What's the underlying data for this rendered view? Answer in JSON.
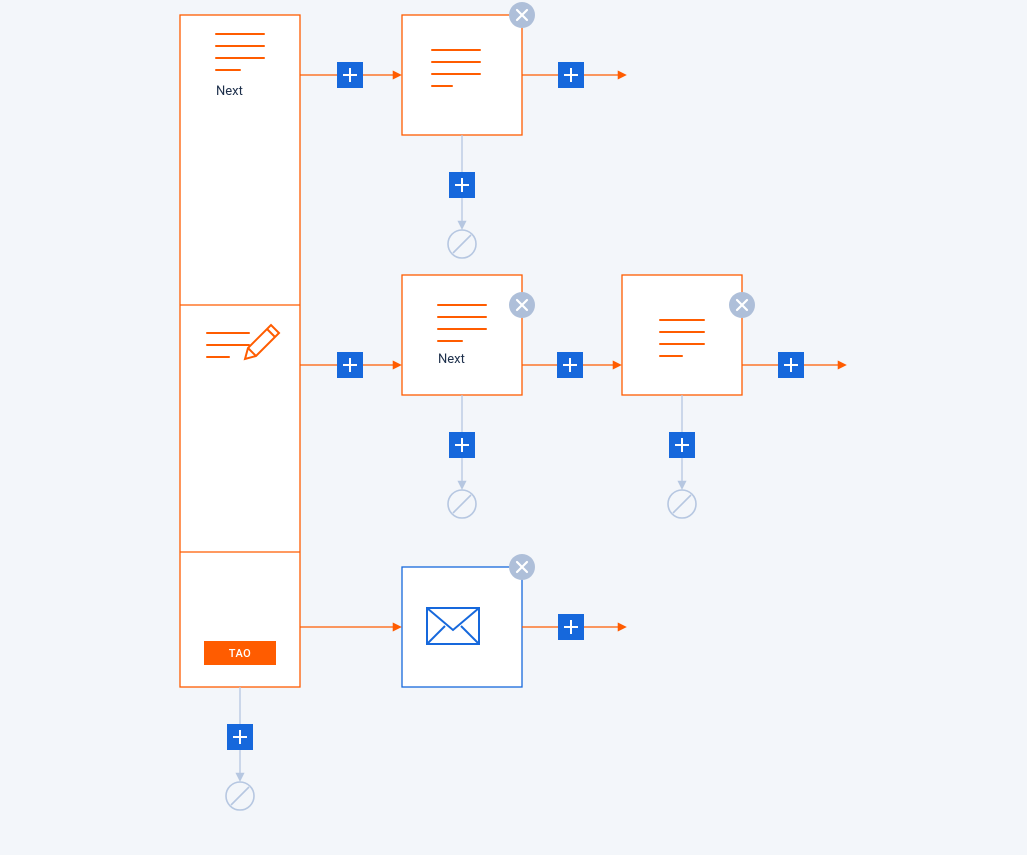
{
  "colors": {
    "bg": "#F3F6FA",
    "orange": "#FF5C00",
    "blue": "#1668DC",
    "textDark": "#1D2F4B",
    "lightBlue": "#B6C7E1",
    "closeFill": "#AEBFD9"
  },
  "rootStack": {
    "badge": "TAO",
    "segments": {
      "seg1": {
        "label": "Next",
        "icon": "lines-left"
      },
      "seg2": {
        "icon": "edit"
      },
      "seg3": {
        "badge": "TAO"
      }
    }
  },
  "rows": {
    "row1": {
      "plusMid": true,
      "node": {
        "icon": "lines-left-short",
        "closable": true,
        "label": ""
      },
      "plusRight": true,
      "endArrow": true,
      "plusDown": true,
      "endCircle": true
    },
    "row2": {
      "plusMid": true,
      "nodeA": {
        "icon": "lines-left-short",
        "label": "Next",
        "closable": true
      },
      "plusAB": true,
      "nodeB": {
        "icon": "lines-center",
        "label": "",
        "closable": true
      },
      "plusRight": true,
      "endArrow": true,
      "plusDownA": true,
      "endCircleA": true,
      "plusDownB": true,
      "endCircleB": true
    },
    "row3": {
      "noMidPlus": true,
      "node": {
        "icon": "mail",
        "closable": true,
        "label": "",
        "borderColor": "blue"
      },
      "plusRight": true,
      "endArrow": true
    }
  },
  "rootDown": {
    "plus": true,
    "endCircle": true
  },
  "icons": {
    "lines": "lines-icon",
    "edit": "edit-icon",
    "mail": "mail-icon",
    "plus": "plus-icon",
    "close": "close-icon",
    "noEntry": "no-entry-icon"
  }
}
